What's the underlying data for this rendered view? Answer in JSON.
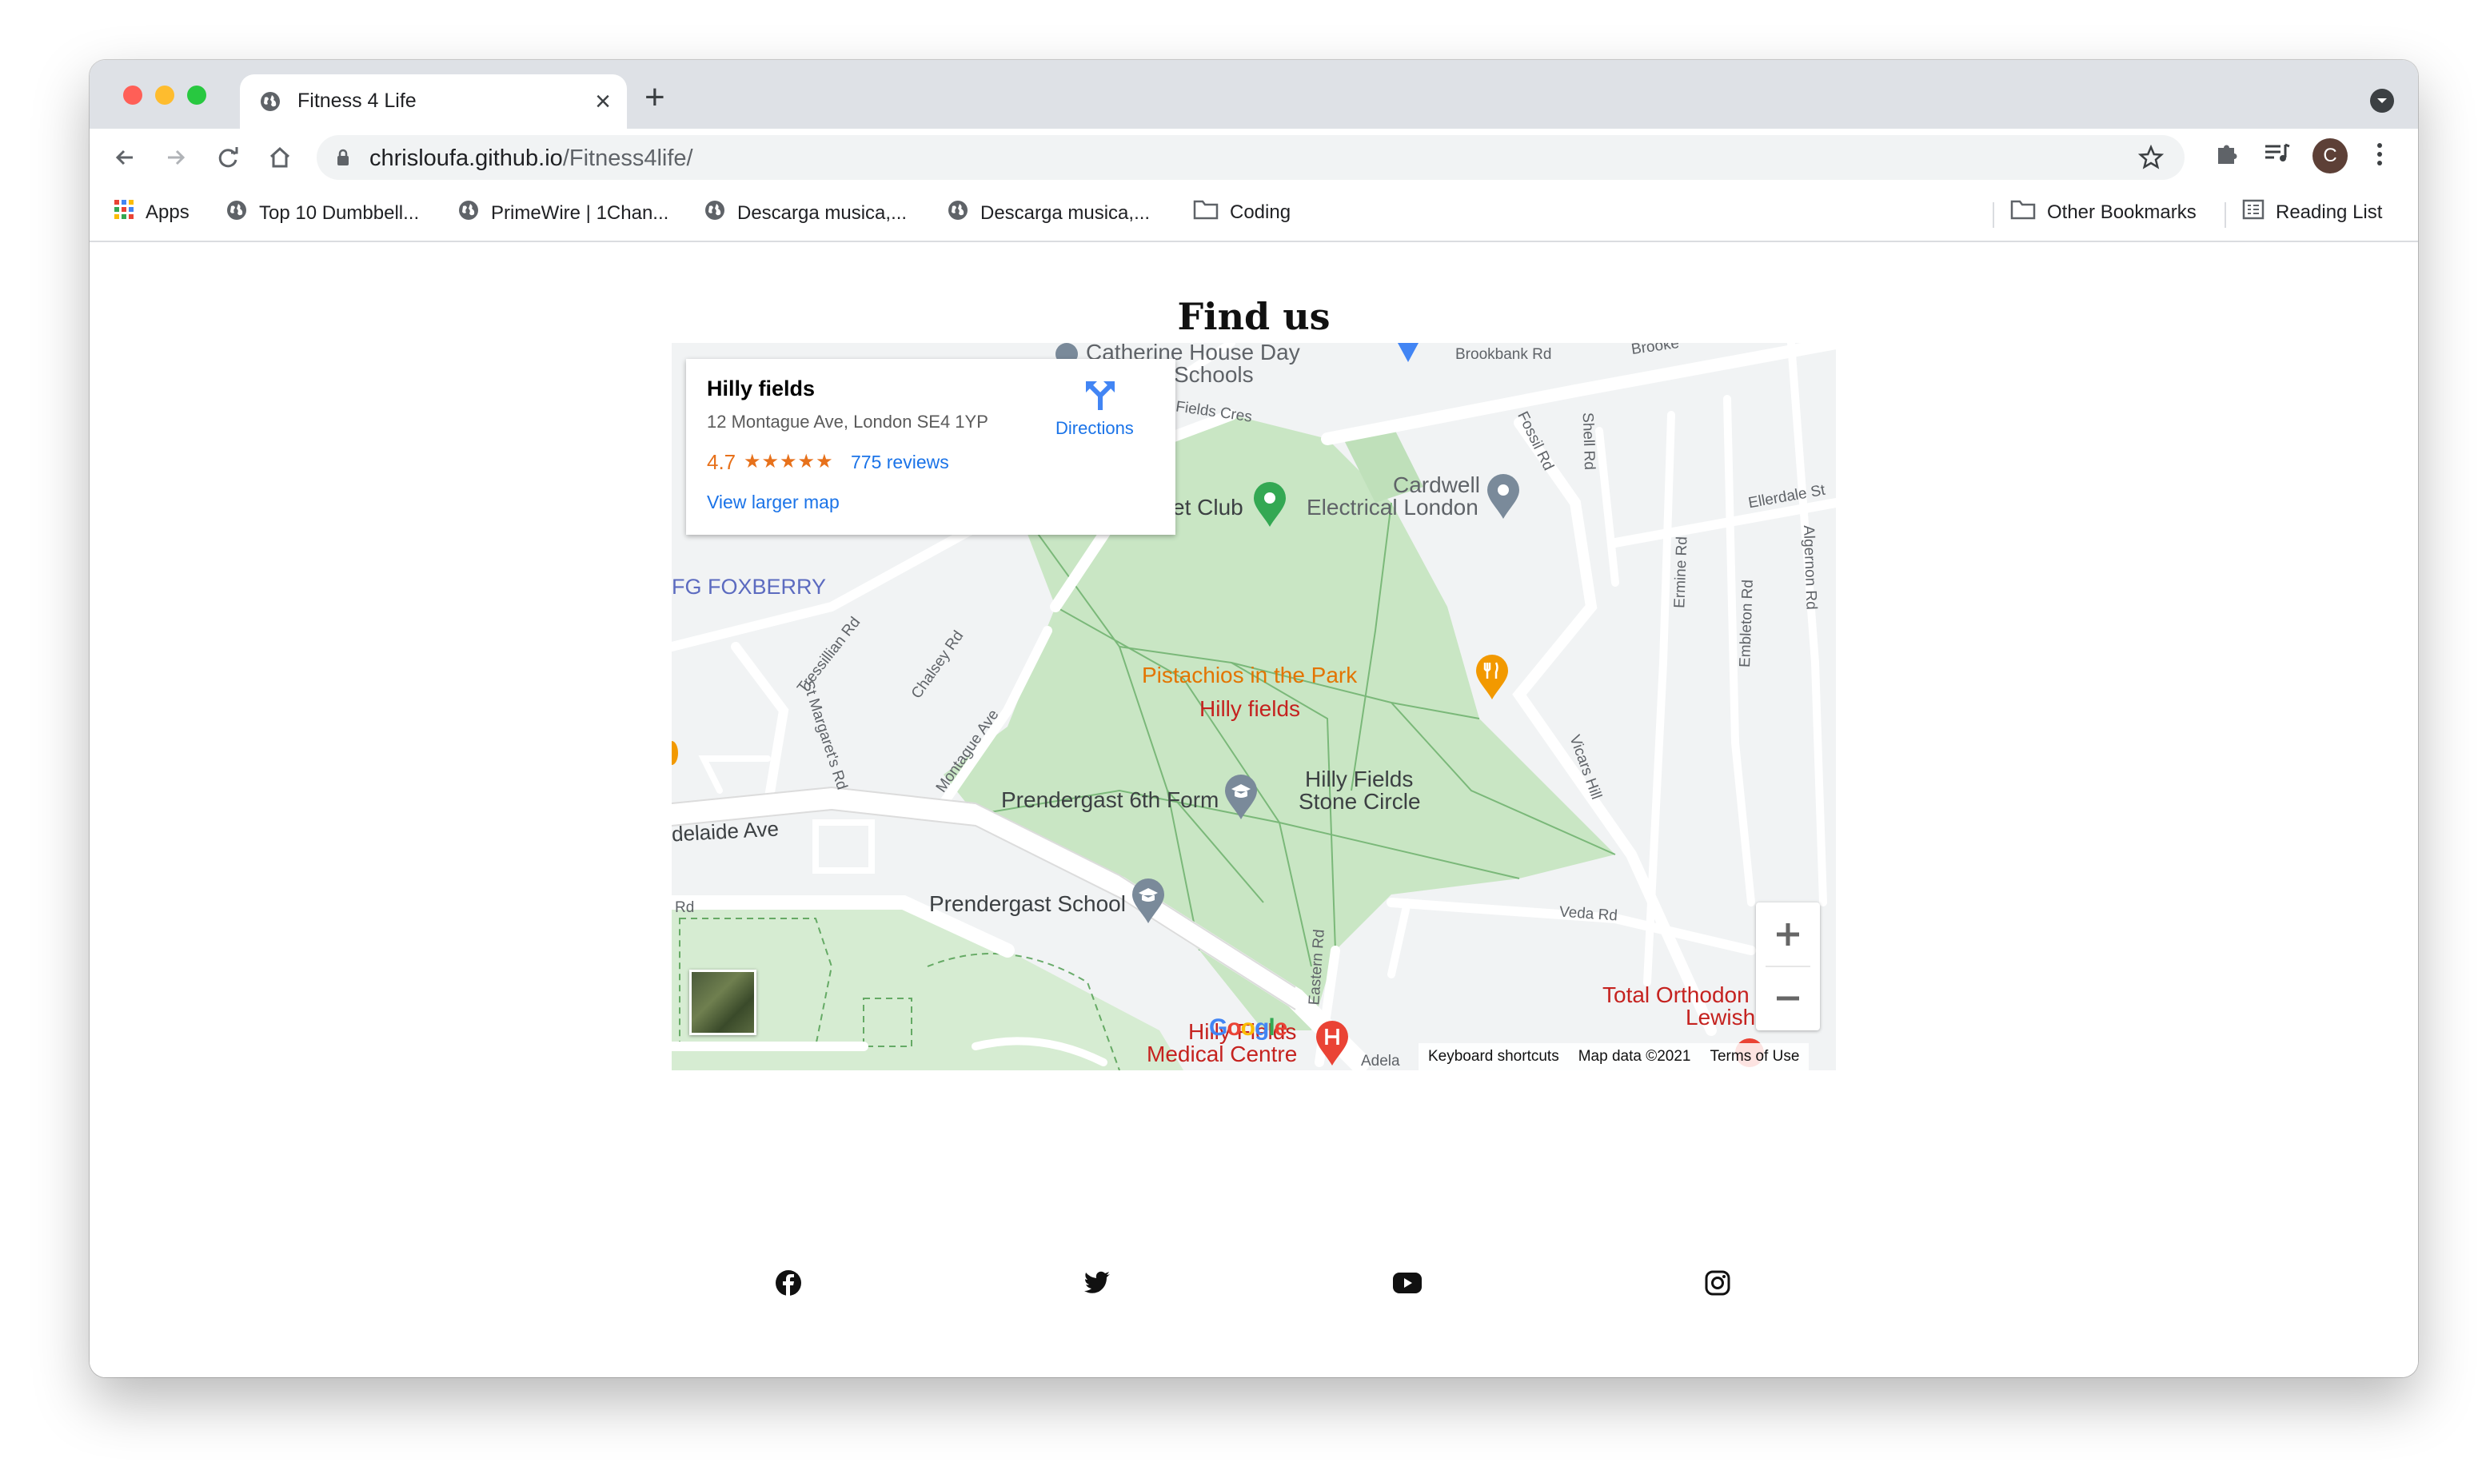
{
  "browser": {
    "tab_title": "Fitness 4 Life",
    "url_host": "chrisloufa.github.io",
    "url_path": "/Fitness4life/",
    "avatar_letter": "C",
    "bookmarks": [
      {
        "label": "Apps",
        "icon": "apps-grid-icon"
      },
      {
        "label": "Top 10 Dumbbell...",
        "icon": "globe-icon"
      },
      {
        "label": "PrimeWire | 1Chan...",
        "icon": "globe-icon"
      },
      {
        "label": "Descarga musica,...",
        "icon": "globe-icon"
      },
      {
        "label": "Descarga musica,...",
        "icon": "globe-icon"
      },
      {
        "label": "Coding",
        "icon": "folder-icon"
      }
    ],
    "other_bookmarks": "Other Bookmarks",
    "reading_list": "Reading List"
  },
  "page": {
    "heading": "Find us"
  },
  "map": {
    "place_name": "Hilly fields",
    "address": "12 Montague Ave, London SE4 1YP",
    "rating": "4.7",
    "stars": "★★★★★",
    "reviews": "775 reviews",
    "view_larger": "View larger map",
    "directions": "Directions",
    "google_logo": "Google",
    "attribution": {
      "shortcuts": "Keyboard shortcuts",
      "map_data": "Map data ©2021",
      "terms": "Terms of Use"
    },
    "labels": {
      "catherine": "Catherine House Day",
      "schools": "Schools",
      "brookbank": "Brookbank Rd",
      "brook2": "Brooke",
      "fields_cres": "Fields Cres",
      "club": "et Club",
      "cardwell": "Cardwell",
      "electrical": "Electrical London",
      "fossil": "Fossil Rd",
      "shell": "Shell Rd",
      "ellerdale": "Ellerdale St",
      "algernon": "Algernon Rd",
      "foxberry": "FG FOXBERRY",
      "tressillian": "Tressillian Rd",
      "chalsey": "Chalsey Rd",
      "ermine": "Ermine Rd",
      "embleton": "Embleton Rd",
      "pistachios": "Pistachios in the Park",
      "hilly_fields": "Hilly fields",
      "st_margarets": "St Margaret's Rd",
      "montague": "Montague Ave",
      "vicars": "Vicars Hill",
      "hf_stone1": "Hilly Fields",
      "hf_stone2": "Stone Circle",
      "prendergast6": "Prendergast 6th Form",
      "adelaide": "delaide Ave",
      "rd": "Rd",
      "prendergast_school": "Prendergast School",
      "veda": "Veda Rd",
      "eastern": "Eastern Rd",
      "total_orth": "Total Orthodon",
      "lewish": "Lewish",
      "hilly_fields_med": "Hilly Fields",
      "medical_centre": "Medical Centre",
      "adela": "Adela"
    }
  },
  "social": [
    "facebook-icon",
    "twitter-icon",
    "youtube-icon",
    "instagram-icon"
  ],
  "colors": {
    "park": "#c9e6c4",
    "road": "#ffffff",
    "link_blue": "#1a73e8",
    "rating_orange": "#e7711b",
    "poi_red": "#c5221f"
  }
}
